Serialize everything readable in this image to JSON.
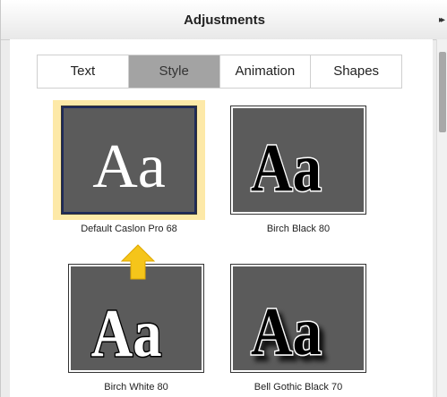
{
  "panel": {
    "title": "Adjustments"
  },
  "tabs": [
    {
      "label": "Text",
      "active": false
    },
    {
      "label": "Style",
      "active": true
    },
    {
      "label": "Animation",
      "active": false
    },
    {
      "label": "Shapes",
      "active": false
    }
  ],
  "styles": [
    {
      "name": "Default Caslon Pro 68",
      "sample": "Aa",
      "selected": true
    },
    {
      "name": "Birch Black 80",
      "sample": "Aa",
      "selected": false
    },
    {
      "name": "Birch White 80",
      "sample": "Aa",
      "selected": false
    },
    {
      "name": "Bell Gothic Black 70",
      "sample": "Aa",
      "selected": false
    }
  ],
  "colors": {
    "highlight": "#fde9a8",
    "arrow": "#f5c51a",
    "thumb_bg": "#5b5b5b",
    "active_tab": "#a3a3a3"
  },
  "icons": {
    "collapse": "double-chevron-right-icon",
    "pointer": "up-arrow-icon"
  }
}
